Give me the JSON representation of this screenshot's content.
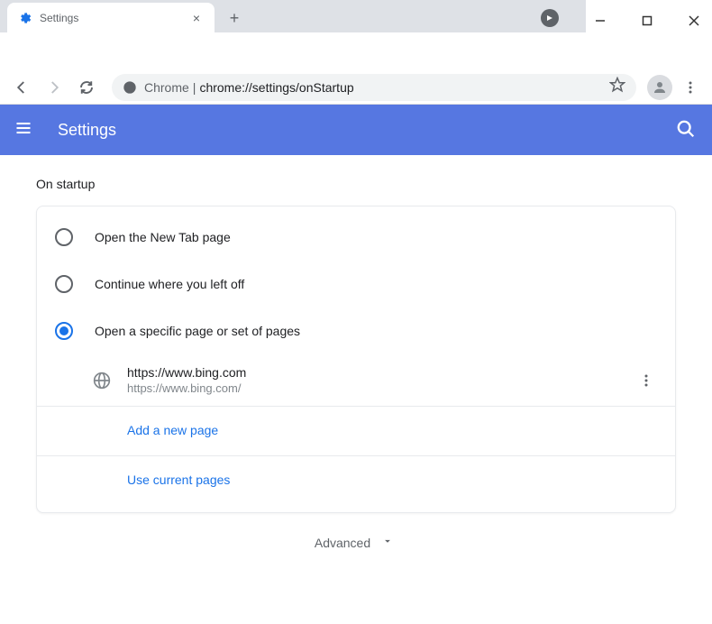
{
  "window": {
    "tab_title": "Settings"
  },
  "toolbar": {
    "origin": "Chrome",
    "path": "chrome://settings/onStartup"
  },
  "header": {
    "title": "Settings"
  },
  "section": {
    "title": "On startup",
    "options": [
      {
        "label": "Open the New Tab page",
        "selected": false
      },
      {
        "label": "Continue where you left off",
        "selected": false
      },
      {
        "label": "Open a specific page or set of pages",
        "selected": true
      }
    ],
    "pages": [
      {
        "title": "https://www.bing.com",
        "url": "https://www.bing.com/"
      }
    ],
    "add_page_label": "Add a new page",
    "use_current_label": "Use current pages"
  },
  "advanced_label": "Advanced"
}
